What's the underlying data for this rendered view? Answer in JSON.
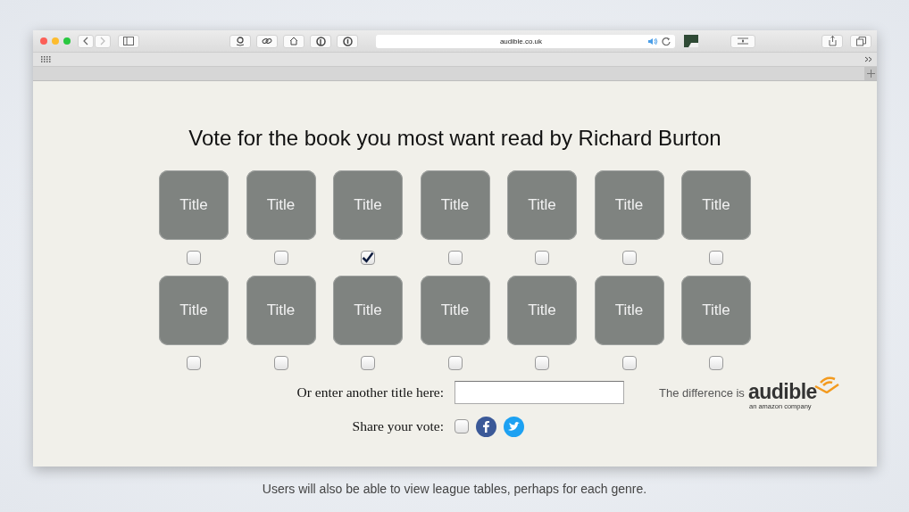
{
  "browser": {
    "url": "audible.co.uk"
  },
  "heading": "Vote for the book you most want read by Richard Burton",
  "books": [
    {
      "label": "Title",
      "checked": false
    },
    {
      "label": "Title",
      "checked": false
    },
    {
      "label": "Title",
      "checked": true
    },
    {
      "label": "Title",
      "checked": false
    },
    {
      "label": "Title",
      "checked": false
    },
    {
      "label": "Title",
      "checked": false
    },
    {
      "label": "Title",
      "checked": false
    },
    {
      "label": "Title",
      "checked": false
    },
    {
      "label": "Title",
      "checked": false
    },
    {
      "label": "Title",
      "checked": false
    },
    {
      "label": "Title",
      "checked": false
    },
    {
      "label": "Title",
      "checked": false
    },
    {
      "label": "Title",
      "checked": false
    },
    {
      "label": "Title",
      "checked": false
    }
  ],
  "other_title": {
    "label": "Or enter another title here:"
  },
  "share": {
    "label": "Share your vote:",
    "checked": false
  },
  "logo": {
    "tagline": "The difference is",
    "brand": "audible",
    "sub": "an amazon company"
  },
  "caption": "Users will also be able to view league tables, perhaps for each genre."
}
